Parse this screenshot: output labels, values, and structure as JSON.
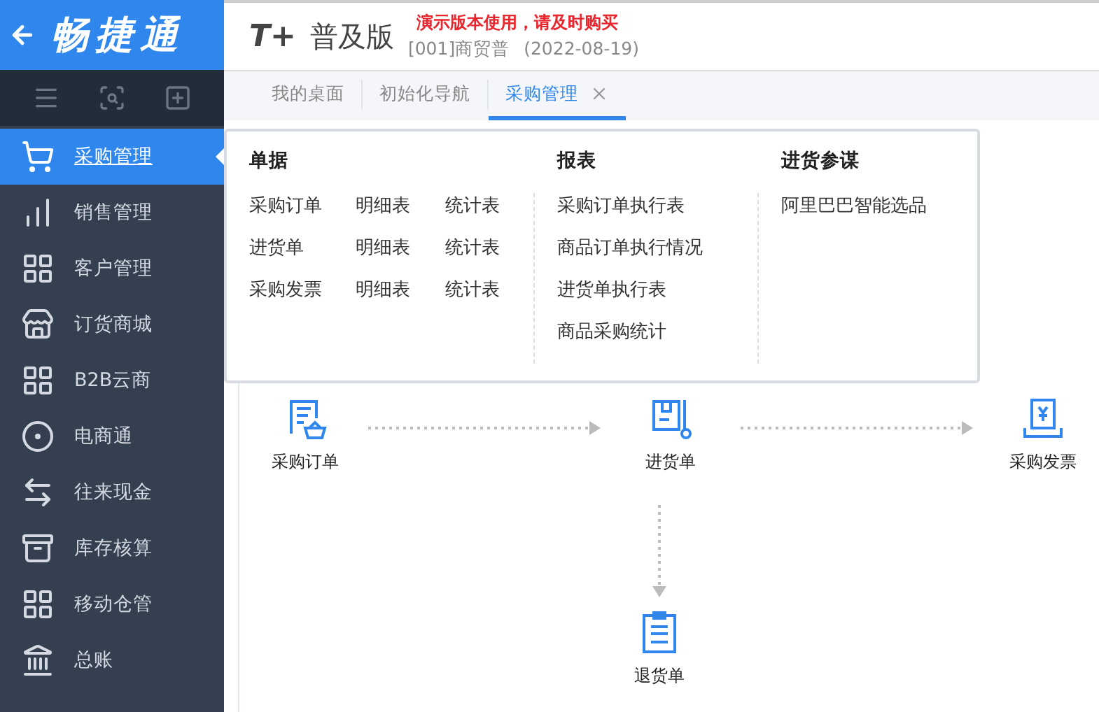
{
  "brand": {
    "name": "畅捷通"
  },
  "header": {
    "logo_mark": "T+",
    "product": "普及版",
    "notice": "演示版本使用，请及时购买",
    "account": "[001]商贸普",
    "date": "(2022-08-19)"
  },
  "toolbar": [
    {
      "kind": "menu"
    },
    {
      "kind": "search"
    },
    {
      "kind": "add"
    }
  ],
  "sidebar": {
    "items": [
      {
        "label": "采购管理",
        "kind": "cart",
        "selected": true
      },
      {
        "label": "销售管理",
        "kind": "chart",
        "selected": false
      },
      {
        "label": "客户管理",
        "kind": "apps",
        "selected": false
      },
      {
        "label": "订货商城",
        "kind": "store",
        "selected": false
      },
      {
        "label": "B2B云商",
        "kind": "apps",
        "selected": false
      },
      {
        "label": "电商通",
        "kind": "circle",
        "selected": false
      },
      {
        "label": "往来现金",
        "kind": "swap",
        "selected": false
      },
      {
        "label": "库存核算",
        "kind": "stock",
        "selected": false
      },
      {
        "label": "移动仓管",
        "kind": "apps",
        "selected": false
      },
      {
        "label": "总账",
        "kind": "ledger",
        "selected": false
      }
    ]
  },
  "tabs": [
    {
      "label": "我的桌面",
      "selected": false,
      "closable": false
    },
    {
      "label": "初始化导航",
      "selected": false,
      "closable": false
    },
    {
      "label": "采购管理",
      "selected": true,
      "closable": true
    }
  ],
  "menu": {
    "columns": [
      {
        "title": "单据",
        "kind": "grid",
        "rows": [
          [
            "采购订单",
            "明细表",
            "统计表"
          ],
          [
            "进货单",
            "明细表",
            "统计表"
          ],
          [
            "采购发票",
            "明细表",
            "统计表"
          ]
        ]
      },
      {
        "title": "报表",
        "kind": "list",
        "items": [
          "采购订单执行表",
          "商品订单执行情况",
          "进货单执行表",
          "商品采购统计"
        ]
      },
      {
        "title": "进货参谋",
        "kind": "list",
        "items": [
          "阿里巴巴智能选品"
        ]
      }
    ]
  },
  "flow": {
    "nodes": [
      {
        "label": "采购订单",
        "kind": "order"
      },
      {
        "label": "进货单",
        "kind": "receipt"
      },
      {
        "label": "采购发票",
        "kind": "invoice"
      }
    ],
    "return_node": {
      "label": "退货单",
      "kind": "return"
    }
  }
}
